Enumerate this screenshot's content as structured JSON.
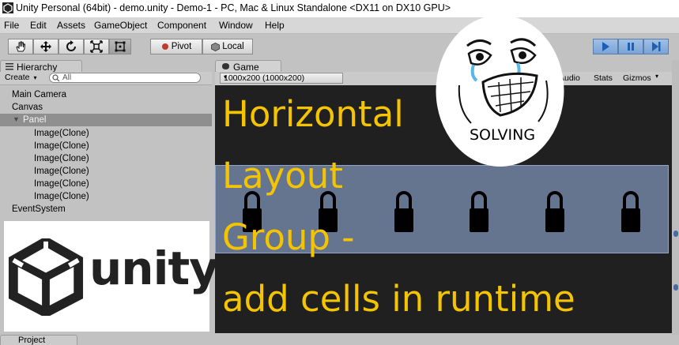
{
  "window": {
    "title": "Unity Personal (64bit) - demo.unity - Demo-1 - PC, Mac & Linux Standalone <DX11 on DX10 GPU>"
  },
  "menu": [
    "File",
    "Edit",
    "Assets",
    "GameObject",
    "Component",
    "Window",
    "Help"
  ],
  "toolbar": {
    "tools": [
      "hand-icon",
      "move-icon",
      "rotate-icon",
      "scale-icon",
      "rect-icon"
    ],
    "pivot_label": "Pivot",
    "local_label": "Local",
    "play": [
      "play-icon",
      "pause-icon",
      "step-icon"
    ]
  },
  "hierarchy": {
    "tab_label": "Hierarchy",
    "create_label": "Create",
    "search_placeholder": "All",
    "items": [
      {
        "label": "Main Camera"
      },
      {
        "label": "Canvas"
      },
      {
        "label": "Panel"
      },
      {
        "label": "Image(Clone)"
      },
      {
        "label": "Image(Clone)"
      },
      {
        "label": "Image(Clone)"
      },
      {
        "label": "Image(Clone)"
      },
      {
        "label": "Image(Clone)"
      },
      {
        "label": "Image(Clone)"
      },
      {
        "label": "EventSystem"
      }
    ]
  },
  "logo": {
    "text": "unity"
  },
  "game": {
    "tab_label": "Game",
    "resolution": "1000x200 (1000x200)",
    "audio_label": "Audio",
    "stats_label": "Stats",
    "gizmos_label": "Gizmos",
    "lock_count": 6
  },
  "overlay": {
    "lines": [
      "Horizontal",
      "Layout",
      "Group -",
      "add cells in runtime"
    ],
    "meme_text": "SOLVING"
  },
  "project": {
    "tab_label": "Project"
  },
  "colors": {
    "accent_text": "#f5c400",
    "panel": "#66758f",
    "game_bg": "#202020"
  }
}
